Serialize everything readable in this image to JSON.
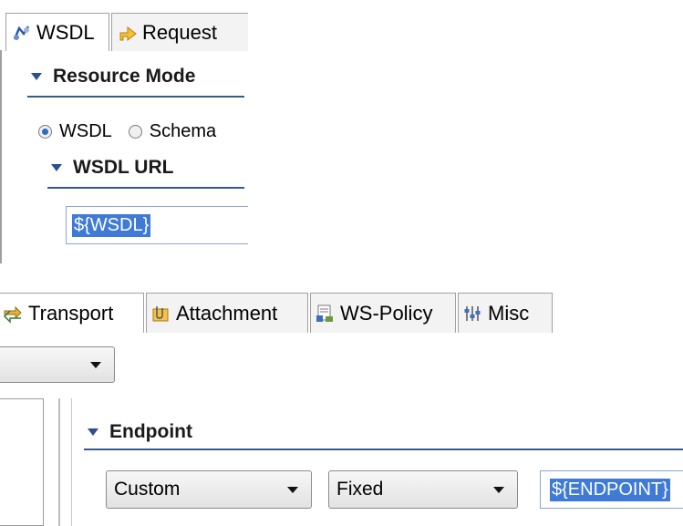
{
  "top_panel": {
    "tabs": [
      {
        "label": "WSDL",
        "icon": "wsdl-icon",
        "active": true
      },
      {
        "label": "Request",
        "icon": "request-icon",
        "active": false
      }
    ],
    "resource_mode_title": "Resource Mode",
    "radio_options": [
      {
        "label": "WSDL",
        "selected": true
      },
      {
        "label": "Schema",
        "selected": false
      }
    ],
    "wsdl_url_title": "WSDL URL",
    "wsdl_url_value": "${WSDL}"
  },
  "bottom_panel": {
    "tabs": [
      {
        "label": "Transport",
        "icon": "transport-icon",
        "active": true
      },
      {
        "label": "Attachment",
        "icon": "attachment-icon",
        "active": false
      },
      {
        "label": "WS-Policy",
        "icon": "ws-policy-icon",
        "active": false
      },
      {
        "label": "Misc",
        "icon": "misc-icon",
        "active": false
      }
    ],
    "top_combo_value": "",
    "endpoint_title": "Endpoint",
    "endpoint_type": "Custom",
    "endpoint_mode": "Fixed",
    "endpoint_value": "${ENDPOINT}"
  },
  "colors": {
    "accent": "#375a8c",
    "selection": "#3e7ad6",
    "field_border": "#8aa6d2"
  }
}
